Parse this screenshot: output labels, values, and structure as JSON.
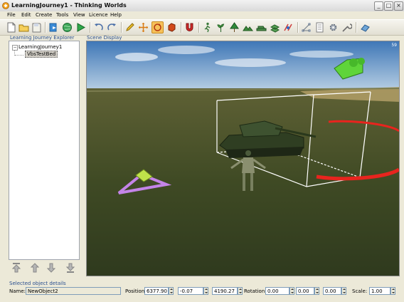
{
  "window": {
    "title": "LearningJourney1 - Thinking Worlds",
    "min_glyph": "_",
    "max_glyph": "□",
    "close_glyph": "×"
  },
  "menu": [
    "File",
    "Edit",
    "Create",
    "Tools",
    "View",
    "Licence",
    "Help"
  ],
  "toolbar": {
    "icons": [
      "new-file-icon",
      "open-folder-icon",
      "save-icon",
      "import-icon",
      "globe-icon",
      "play-icon",
      "undo-icon",
      "redo-icon",
      "pencil-icon",
      "move-icon",
      "rotate-icon",
      "scale-icon",
      "magnet-icon",
      "walk-icon",
      "plant-icon",
      "tree-icon",
      "terrain-icon",
      "vehicle-icon",
      "stack-icon",
      "link-icon",
      "network-icon",
      "document-icon",
      "settings-icon",
      "tool-icon",
      "publish-icon"
    ],
    "active": "rotate-icon"
  },
  "explorer": {
    "title": "Learning Journey Explorer",
    "toggle": "−",
    "root": "LearningJourney1",
    "child": "VbsTestBed"
  },
  "scene": {
    "title": "Scene Display",
    "fps": "59"
  },
  "details": {
    "title": "Selected object details",
    "name_label": "Name:",
    "name_value": "NewObject2",
    "position_label": "Position:",
    "position": [
      "6377.90",
      "-0.07",
      "4190.27"
    ],
    "rotation_label": "Rotation:",
    "rotation": [
      "0.00",
      "0.00",
      "0.00"
    ],
    "scale_label": "Scale:",
    "scale": "1.00"
  },
  "colors": {
    "accent": "#2a4f8f",
    "selection": "#f6c15a",
    "bounding_box": "#ffffff",
    "marker_ring": "#e8241e",
    "trigger": "#c484e8"
  }
}
